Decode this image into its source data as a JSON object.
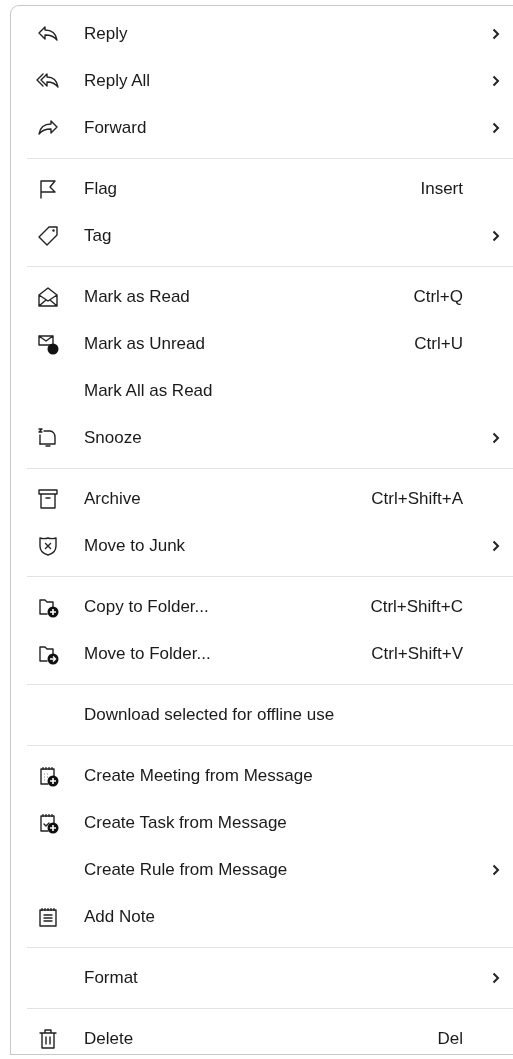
{
  "sections": [
    {
      "items": [
        {
          "label": "Reply",
          "has_submenu": true
        },
        {
          "label": "Reply All",
          "has_submenu": true
        },
        {
          "label": "Forward",
          "has_submenu": true
        }
      ]
    },
    {
      "items": [
        {
          "label": "Flag",
          "shortcut": "Insert",
          "has_submenu": false
        },
        {
          "label": "Tag",
          "has_submenu": true
        }
      ]
    },
    {
      "items": [
        {
          "label": "Mark as Read",
          "shortcut": "Ctrl+Q",
          "has_submenu": false
        },
        {
          "label": "Mark as Unread",
          "shortcut": "Ctrl+U",
          "has_submenu": false
        },
        {
          "label": "Mark All as Read",
          "has_submenu": false
        },
        {
          "label": "Snooze",
          "has_submenu": true
        }
      ]
    },
    {
      "items": [
        {
          "label": "Archive",
          "shortcut": "Ctrl+Shift+A",
          "has_submenu": false
        },
        {
          "label": "Move to Junk",
          "has_submenu": true
        }
      ]
    },
    {
      "items": [
        {
          "label": "Copy to Folder...",
          "shortcut": "Ctrl+Shift+C",
          "has_submenu": false
        },
        {
          "label": "Move to Folder...",
          "shortcut": "Ctrl+Shift+V",
          "has_submenu": false
        }
      ]
    },
    {
      "items": [
        {
          "label": "Download selected for offline use",
          "has_submenu": false
        }
      ]
    },
    {
      "items": [
        {
          "label": "Create Meeting from Message",
          "has_submenu": false
        },
        {
          "label": "Create Task from Message",
          "has_submenu": false
        },
        {
          "label": "Create Rule from Message",
          "has_submenu": true
        },
        {
          "label": "Add Note",
          "has_submenu": false
        }
      ]
    },
    {
      "items": [
        {
          "label": "Format",
          "has_submenu": true
        }
      ]
    },
    {
      "items": [
        {
          "label": "Delete",
          "shortcut": "Del",
          "has_submenu": false
        }
      ]
    }
  ]
}
